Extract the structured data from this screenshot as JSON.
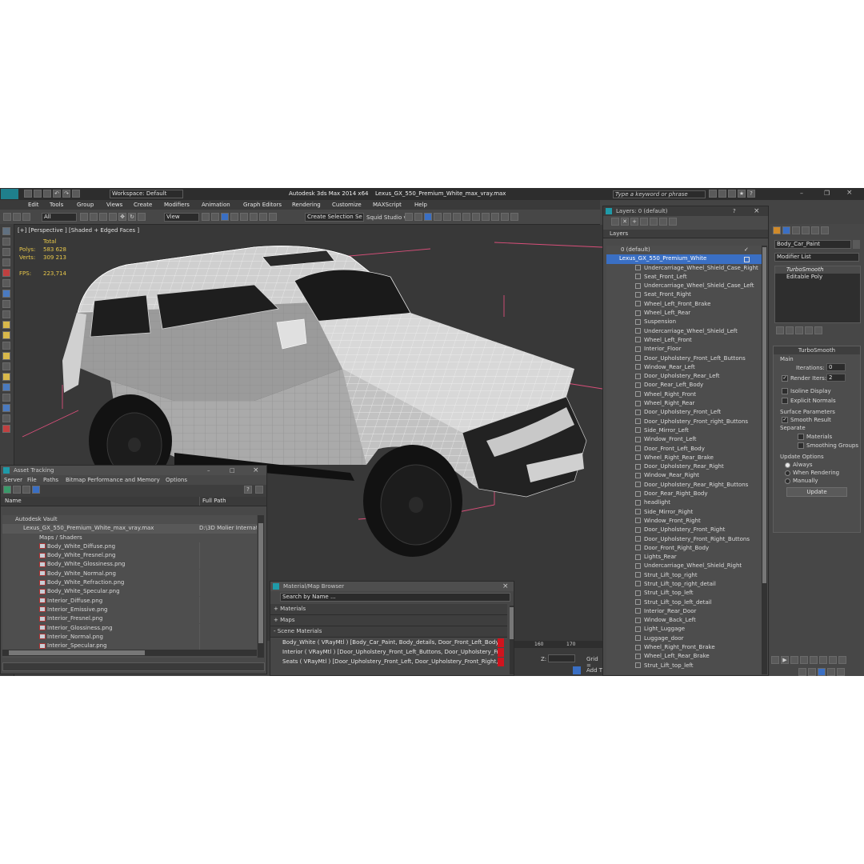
{
  "title_bar": {
    "workspace": "Workspace: Default",
    "app_title": "Autodesk 3ds Max  2014 x64",
    "file_title": "Lexus_GX_550_Premium_White_max_vray.max",
    "search_placeholder": "Type a keyword or phrase"
  },
  "menu": [
    "Edit",
    "Tools",
    "Group",
    "Views",
    "Create",
    "Modifiers",
    "Animation",
    "Graph Editors",
    "Rendering",
    "Customize",
    "MAXScript",
    "Help"
  ],
  "toolbar": {
    "filter": "All",
    "ref_coord": "View",
    "selection_set": "Create Selection Se",
    "studio": "Squid Studio v"
  },
  "viewport": {
    "label": "[+] [Perspective ] [Shaded + Edged Faces ]",
    "stats": {
      "total_label": "Total",
      "polys_label": "Polys:",
      "polys": "583 628",
      "verts_label": "Verts:",
      "verts": "309 213",
      "fps_label": "FPS:",
      "fps": "223,714"
    }
  },
  "layers": {
    "title": "Layers: 0 (default)",
    "help": "?",
    "close": "×",
    "header": "Layers",
    "default_layer": "0 (default)",
    "selected_layer": "Lexus_GX_550_Premium_White",
    "items": [
      "Undercarriage_Wheel_Shield_Case_Right",
      "Seat_Front_Left",
      "Undercarriage_Wheel_Shield_Case_Left",
      "Seat_Front_Right",
      "Wheel_Left_Front_Brake",
      "Wheel_Left_Rear",
      "Suspension",
      "Undercarriage_Wheel_Shield_Left",
      "Wheel_Left_Front",
      "Interior_Floor",
      "Door_Upholstery_Front_Left_Buttons",
      "Window_Rear_Left",
      "Door_Upholstery_Rear_Left",
      "Door_Rear_Left_Body",
      "Wheel_Right_Front",
      "Wheel_Right_Rear",
      "Door_Upholstery_Front_Left",
      "Door_Upholstery_Front_right_Buttons",
      "Side_Mirror_Left",
      "Window_Front_Left",
      "Door_Front_Left_Body",
      "Wheel_Right_Rear_Brake",
      "Door_Upholstery_Rear_Right",
      "Window_Rear_Right",
      "Door_Upholstery_Rear_Right_Buttons",
      "Door_Rear_Right_Body",
      "headlight",
      "Side_Mirror_Right",
      "Window_Front_Right",
      "Door_Upholstery_Front_Right",
      "Door_Upholstery_Front_Right_Buttons",
      "Door_Front_Right_Body",
      "Lights_Rear",
      "Undercarriage_Wheel_Shield_Right",
      "Strut_Lift_top_right",
      "Strut_Lift_top_right_detail",
      "Strut_Lift_top_left",
      "Strut_Lift_top_left_detail",
      "Interior_Rear_Door",
      "Window_Back_Left",
      "Light_Luggage",
      "Luggage_door",
      "Wheel_Right_Front_Brake",
      "Wheel_Left_Rear_Brake",
      "Strut_Lift_top_left"
    ]
  },
  "command_panel": {
    "object_name": "Body_Car_Paint",
    "modifier_list": "Modifier List",
    "stack": [
      "TurboSmooth",
      "Editable Poly"
    ],
    "rollout_title": "TurboSmooth",
    "main": "Main",
    "iterations_label": "Iterations:",
    "iterations": "0",
    "render_iters_label": "Render Iters:",
    "render_iters": "2",
    "isoline": "Isoline Display",
    "explicit_normals": "Explicit Normals",
    "surface_params": "Surface Parameters",
    "smooth_result": "Smooth Result",
    "separate": "Separate",
    "materials": "Materials",
    "smoothing_groups": "Smoothing Groups",
    "update_options": "Update Options",
    "always": "Always",
    "when_rendering": "When Rendering",
    "manually": "Manually",
    "update_button": "Update"
  },
  "asset_tracking": {
    "title": "Asset Tracking",
    "menu": [
      "Server",
      "File",
      "Paths",
      "Bitmap Performance and Memory",
      "Options"
    ],
    "col_name": "Name",
    "col_path": "Full Path",
    "vault": "Autodesk Vault",
    "max_file": "Lexus_GX_550_Premium_White_max_vray.max",
    "max_path": "D:\\3D Molier Internati",
    "maps_group": "Maps / Shaders",
    "maps": [
      "Body_White_Diffuse.png",
      "Body_White_Fresnel.png",
      "Body_White_Glossiness.png",
      "Body_White_Normal.png",
      "Body_White_Refraction.png",
      "Body_White_Specular.png",
      "Interior_Diffuse.png",
      "Interior_Emissive.png",
      "Interior_Fresnel.png",
      "Interior_Glossiness.png",
      "Interior_Normal.png",
      "Interior_Specular.png"
    ]
  },
  "material_browser": {
    "title": "Material/Map Browser",
    "search_placeholder": "Search by Name ...",
    "sections": [
      "+ Materials",
      "+ Maps",
      "- Scene Materials"
    ],
    "items": [
      "Body_White ( VRayMtl ) [Body_Car_Paint, Body_details, Door_Front_Left_Body,...",
      "Interior ( VRayMtl ) [Door_Upholstery_Front_Left_Buttons, Door_Upholstery_Fr...",
      "Seats ( VRayMtl ) [Door_Upholstery_Front_Left, Door_Upholstery_Front_Right,..."
    ]
  },
  "timeline": {
    "ticks": [
      "160",
      "170"
    ],
    "z_label": "Z:",
    "grid_label": "Grid =",
    "add_t": "Add T"
  },
  "colors": {
    "accent": "#1f9aa8",
    "selection": "#3a6fc4",
    "material_swatch": "#d0141e",
    "stats_yellow": "#e8c84a",
    "pink_bbox": "#d94f7a"
  }
}
